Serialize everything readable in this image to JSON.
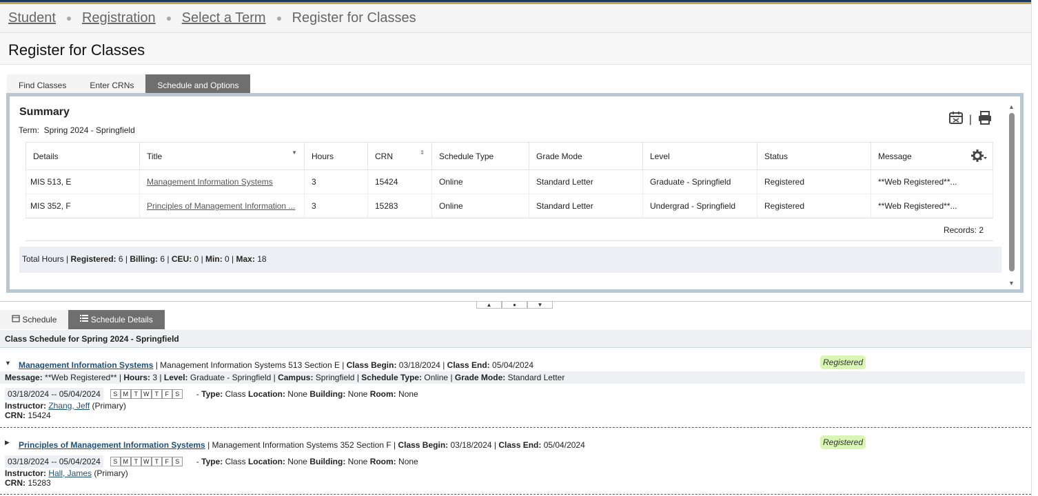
{
  "breadcrumb": {
    "items": [
      "Student",
      "Registration",
      "Select a Term"
    ],
    "current": "Register for Classes"
  },
  "page_title": "Register for Classes",
  "tabs": [
    "Find Classes",
    "Enter CRNs",
    "Schedule and Options"
  ],
  "summary": {
    "title": "Summary",
    "term_label": "Term:",
    "term_value": "Spring 2024 - Springfield",
    "columns": [
      "Details",
      "Title",
      "Hours",
      "CRN",
      "Schedule Type",
      "Grade Mode",
      "Level",
      "Status",
      "Message"
    ],
    "rows": [
      [
        "MIS 513, E",
        "Management Information Systems",
        "3",
        "15424",
        "Online",
        "Standard Letter",
        "Graduate - Springfield",
        "Registered",
        "**Web Registered**..."
      ],
      [
        "MIS 352, F",
        "Principles of Management Information ...",
        "3",
        "15283",
        "Online",
        "Standard Letter",
        "Undergrad - Springfield",
        "Registered",
        "**Web Registered**..."
      ]
    ],
    "records": "Records: 2",
    "totals": {
      "prefix": "Total Hours |",
      "registered_label": "Registered:",
      "registered": "6",
      "billing_label": "Billing:",
      "billing": "6",
      "ceu_label": "CEU:",
      "ceu": "0",
      "min_label": "Min:",
      "min": "0",
      "max_label": "Max:",
      "max": "18"
    }
  },
  "bottom_tabs": [
    "Schedule",
    "Schedule Details"
  ],
  "schedule_header": "Class Schedule for Spring 2024 - Springfield",
  "classes": [
    {
      "title": "Management Information Systems",
      "desc": "| Management Information Systems 513 Section E |",
      "begin_label": "Class Begin:",
      "begin": "03/18/2024",
      "end_label": "Class End:",
      "end": "05/04/2024",
      "status": "Registered",
      "message_line": {
        "message_label": "Message:",
        "message": "**Web Registered**",
        "hours_label": "Hours:",
        "hours": "3",
        "level_label": "Level:",
        "level": "Graduate - Springfield",
        "campus_label": "Campus:",
        "campus": "Springfield",
        "stype_label": "Schedule Type:",
        "stype": "Online",
        "gmode_label": "Grade Mode:",
        "gmode": "Standard Letter"
      },
      "dates": "03/18/2024 -- 05/04/2024",
      "days": [
        "S",
        "M",
        "T",
        "W",
        "T",
        "F",
        "S"
      ],
      "type_label": "Type:",
      "type": "Class",
      "loc_label": "Location:",
      "loc": "None",
      "bld_label": "Building:",
      "bld": "None",
      "room_label": "Room:",
      "room": "None",
      "instructor_label": "Instructor:",
      "instructor": "Zhang, Jeff",
      "instructor_role": "(Primary)",
      "crn_label": "CRN:",
      "crn": "15424"
    },
    {
      "title": "Principles of Management Information Systems",
      "desc": "| Management Information Systems 352 Section F |",
      "begin_label": "Class Begin:",
      "begin": "03/18/2024",
      "end_label": "Class End:",
      "end": "05/04/2024",
      "status": "Registered",
      "dates": "03/18/2024 -- 05/04/2024",
      "days": [
        "S",
        "M",
        "T",
        "W",
        "T",
        "F",
        "S"
      ],
      "type_label": "Type:",
      "type": "Class",
      "loc_label": "Location:",
      "loc": "None",
      "bld_label": "Building:",
      "bld": "None",
      "room_label": "Room:",
      "room": "None",
      "instructor_label": "Instructor:",
      "instructor": "Hall, James",
      "instructor_role": "(Primary)",
      "crn_label": "CRN:",
      "crn": "15283"
    }
  ],
  "colors": {
    "accent_navy": "#1f3a5f",
    "accent_gold": "#c8a24a",
    "tab_active": "#6f6f6f",
    "badge_green": "#d9f6b4"
  },
  "icons": [
    "calendar-icon",
    "print-icon",
    "gear-icon",
    "schedule-icon",
    "list-icon"
  ]
}
